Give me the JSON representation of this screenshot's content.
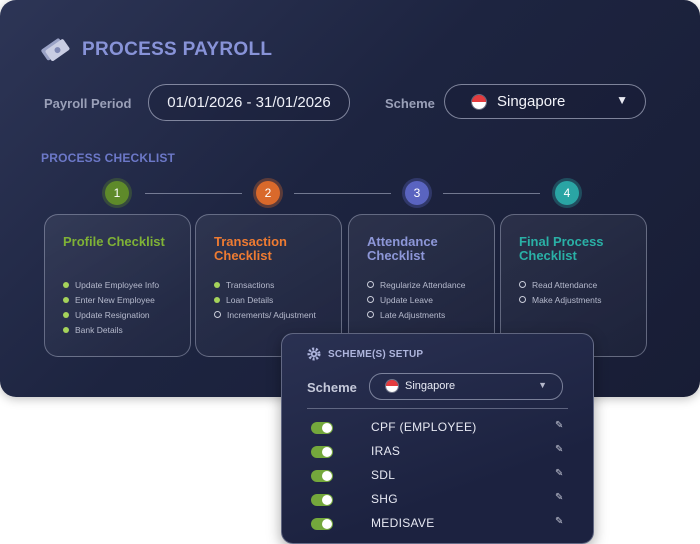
{
  "header": {
    "title": "PROCESS PAYROLL",
    "icon": "money-icon"
  },
  "payroll_period": {
    "label": "Payroll Period",
    "value": "01/01/2026 - 31/01/2026"
  },
  "scheme": {
    "label": "Scheme",
    "value": "Singapore",
    "flag": "singapore-flag-icon"
  },
  "checklist": {
    "heading": "PROCESS CHECKLIST",
    "steps": [
      {
        "number": "1",
        "color": "#5e8a2a",
        "title": "Profile Checklist",
        "title_color": "#7fb236",
        "items": [
          {
            "label": "Update Employee Info",
            "done": true
          },
          {
            "label": "Enter New Employee",
            "done": true
          },
          {
            "label": "Update Resignation",
            "done": true
          },
          {
            "label": "Bank Details",
            "done": true
          }
        ]
      },
      {
        "number": "2",
        "color": "#d9692b",
        "title": "Transaction Checklist",
        "title_color": "#ee7b32",
        "items": [
          {
            "label": "Transactions",
            "done": true
          },
          {
            "label": "Loan Details",
            "done": true
          },
          {
            "label": "Increments/ Adjustment",
            "done": false
          }
        ]
      },
      {
        "number": "3",
        "color": "#5a64c0",
        "title": "Attendance Checklist",
        "title_color": "#8d97d8",
        "items": [
          {
            "label": "Regularize Attendance",
            "done": false
          },
          {
            "label": "Update Leave",
            "done": false
          },
          {
            "label": "Late Adjustments",
            "done": false
          }
        ]
      },
      {
        "number": "4",
        "color": "#2aa5a4",
        "title": "Final Process Checklist",
        "title_color": "#2ab0a6",
        "items": [
          {
            "label": "Read Attendance",
            "done": false
          },
          {
            "label": "Make Adjustments",
            "done": false
          }
        ]
      }
    ]
  },
  "scheme_setup": {
    "title": "SCHEME(S) SETUP",
    "scheme_label": "Scheme",
    "scheme_value": "Singapore",
    "items": [
      {
        "label": "CPF (EMPLOYEE)",
        "enabled": true
      },
      {
        "label": "IRAS",
        "enabled": true
      },
      {
        "label": "SDL",
        "enabled": true
      },
      {
        "label": "SHG",
        "enabled": true
      },
      {
        "label": "MEDISAVE",
        "enabled": true
      }
    ]
  }
}
